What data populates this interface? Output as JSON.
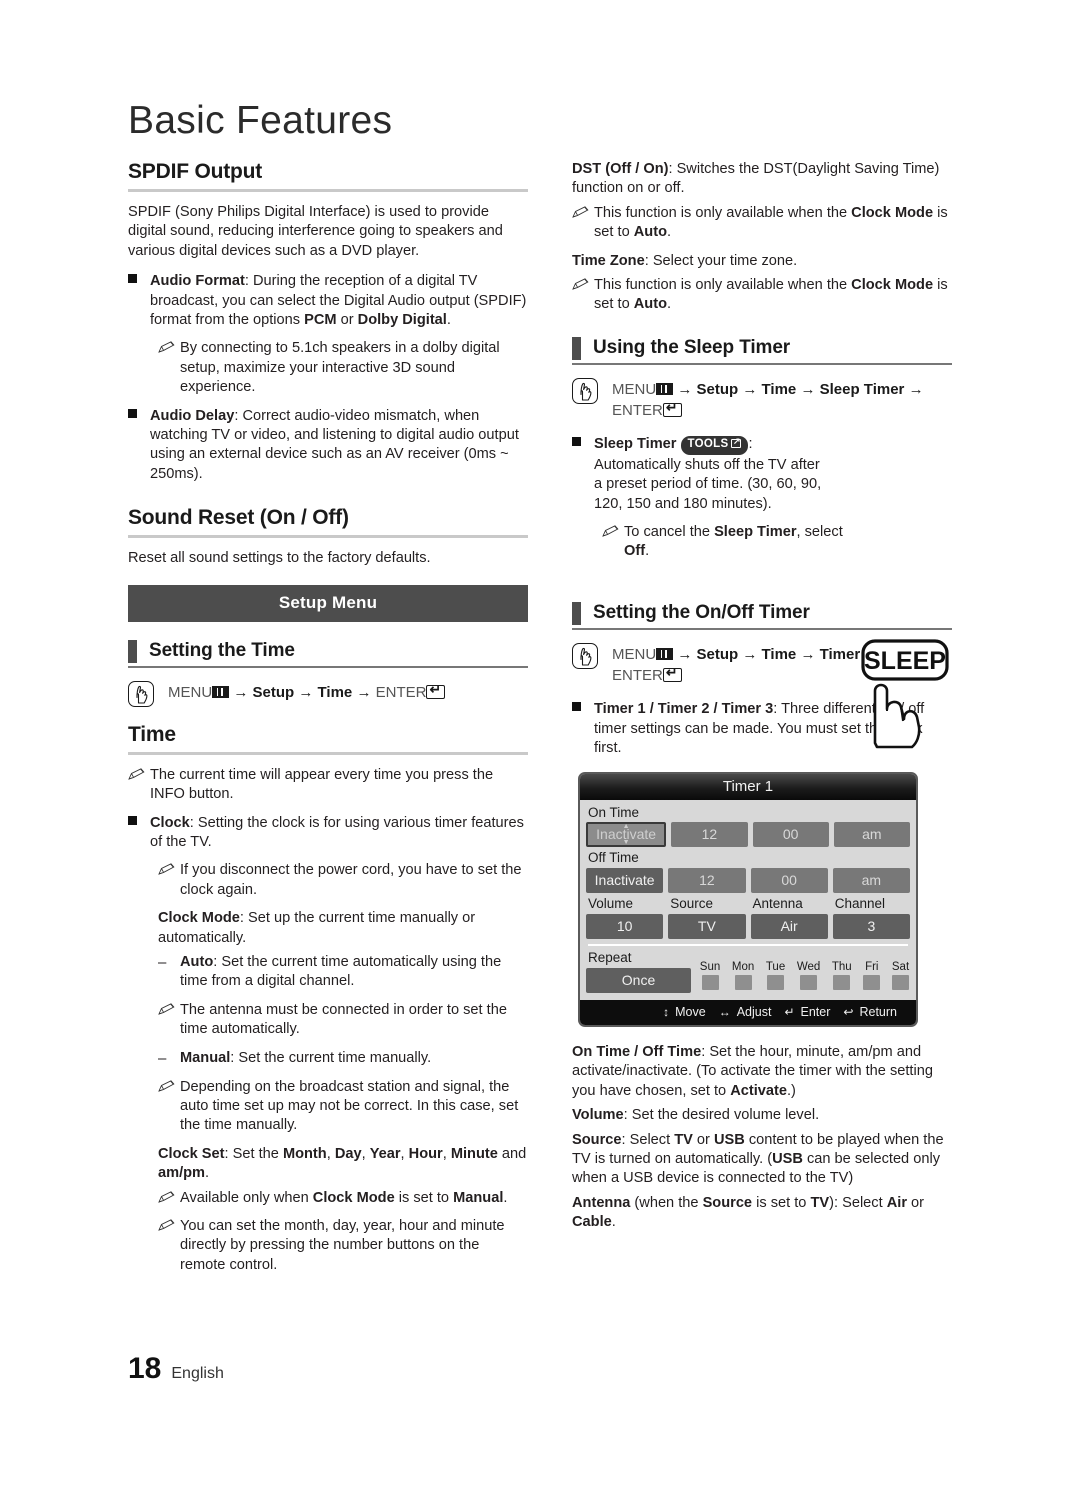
{
  "document": {
    "title": "Basic Features",
    "page_number": "18",
    "language": "English"
  },
  "left_column": {
    "spdif": {
      "heading": "SPDIF Output",
      "intro": "SPDIF (Sony Philips Digital Interface) is used to provide digital sound, reducing interference going to speakers and various digital devices such as a DVD player.",
      "audio_format_term": "Audio Format",
      "audio_format_body": ": During the reception of a digital TV broadcast, you can select the Digital Audio output (SPDIF) format from the options ",
      "audio_format_opt1": "PCM",
      "audio_format_or": " or ",
      "audio_format_opt2": "Dolby Digital",
      "audio_format_end": ".",
      "note_51ch": "By connecting to 5.1ch speakers in a dolby digital setup, maximize your interactive 3D sound experience.",
      "audio_delay_term": "Audio Delay",
      "audio_delay_body": ": Correct audio-video mismatch, when watching TV or video, and listening to digital audio output using an external device such as an AV receiver (0ms ~ 250ms)."
    },
    "sound_reset": {
      "heading": "Sound Reset (On / Off)",
      "body": "Reset all sound settings to the factory defaults."
    },
    "setup_menu_banner": "Setup Menu",
    "setting_the_time": {
      "heading": "Setting the Time",
      "nav": {
        "menu": "MENU",
        "arrow": "→",
        "step1": "Setup",
        "step2": "Time",
        "enter": "ENTER"
      }
    },
    "time": {
      "heading": "Time",
      "note_info_a": "The current time will appear every time you press the ",
      "note_info_b": "INFO",
      "note_info_c": " button.",
      "clock_term": "Clock",
      "clock_body": ": Setting the clock is for using various timer features of the TV.",
      "note_powercord": "If you disconnect the power cord, you have to set the clock again.",
      "clock_mode_term": "Clock Mode",
      "clock_mode_body": ": Set up the current time manually or automatically.",
      "auto_term": "Auto",
      "auto_body": ": Set the current time automatically using the time from a digital channel.",
      "note_antenna": "The antenna must be connected in order to set the time automatically.",
      "manual_term": "Manual",
      "manual_body": ": Set the current time manually.",
      "note_broadcast": "Depending on the broadcast station and signal, the auto time set up may not be correct. In this case, set the time manually.",
      "clock_set_term": "Clock Set",
      "clock_set_b1": ": Set the ",
      "clock_set_fields": [
        "Month",
        "Day",
        "Year",
        "Hour",
        "Minute"
      ],
      "clock_set_b2": " and ",
      "clock_set_ampm": "am/pm",
      "clock_set_end": ".",
      "note_available_a": "Available only when ",
      "note_available_b": "Clock Mode",
      "note_available_c": " is set to ",
      "note_available_d": "Manual",
      "note_available_e": ".",
      "note_numberbuttons": "You can set the month, day, year, hour and minute directly by pressing the number buttons on the remote control."
    }
  },
  "right_column": {
    "dst": {
      "term": "DST (Off / On)",
      "body": ": Switches the DST(Daylight Saving Time) function on or off.",
      "note_a": "This function is only available when the ",
      "note_b": "Clock Mode",
      "note_c": " is set to ",
      "note_d": "Auto",
      "note_e": "."
    },
    "time_zone": {
      "term": "Time Zone",
      "body": ": Select your time zone.",
      "note_a": "This function is only available when the ",
      "note_b": "Clock Mode",
      "note_c": " is set to ",
      "note_d": "Auto",
      "note_e": "."
    },
    "sleep_timer": {
      "heading": "Using the Sleep Timer",
      "nav": {
        "menu": "MENU",
        "arrow": "→",
        "step1": "Setup",
        "step2": "Time",
        "step3": "Sleep Timer",
        "enter": "ENTER"
      },
      "term": "Sleep Timer",
      "tools_badge": "TOOLS",
      "body": ": Automatically shuts off the TV after a preset period of time. (30, 60, 90, 120, 150 and 180 minutes).",
      "note_a": "To cancel the ",
      "note_b": "Sleep Timer",
      "note_c": ", select ",
      "note_d": "Off",
      "note_e": ".",
      "remote_button_label": "SLEEP"
    },
    "onoff_timer": {
      "heading": "Setting the On/Off Timer",
      "nav": {
        "menu": "MENU",
        "arrow": "→",
        "step1": "Setup",
        "step2": "Time",
        "step3": "Timer 1",
        "enter": "ENTER"
      },
      "term": "Timer 1 / Timer 2 / Timer 3",
      "body": ": Three different on / off timer settings can be made. You must set the clock first."
    },
    "timer_dialog": {
      "title": "Timer 1",
      "on_time_label": "On Time",
      "on_time_values": [
        "Inactivate",
        "12",
        "00",
        "am"
      ],
      "on_time_selected_index": 0,
      "off_time_label": "Off Time",
      "off_time_values": [
        "Inactivate",
        "12",
        "00",
        "am"
      ],
      "field_labels": [
        "Volume",
        "Source",
        "Antenna",
        "Channel"
      ],
      "field_values": [
        "10",
        "TV",
        "Air",
        "3"
      ],
      "repeat_label": "Repeat",
      "repeat_value": "Once",
      "days": [
        "Sun",
        "Mon",
        "Tue",
        "Wed",
        "Thu",
        "Fri",
        "Sat"
      ],
      "footer_hints": [
        {
          "key": "↕",
          "label": "Move"
        },
        {
          "key": "↔",
          "label": "Adjust"
        },
        {
          "key": "↵",
          "label": "Enter"
        },
        {
          "key": "↩",
          "label": "Return"
        }
      ]
    },
    "descriptions": {
      "on_off_term": "On Time / Off Time",
      "on_off_b1": ": Set the hour, minute, am/pm and activate/inactivate. (To activate the timer with the setting you have chosen, set to ",
      "on_off_bold": "Activate",
      "on_off_b2": ".)",
      "volume_term": "Volume",
      "volume_body": ": Set the desired volume level.",
      "source_term": "Source",
      "source_b1": ": Select ",
      "source_tv": "TV",
      "source_or": " or ",
      "source_usb": "USB",
      "source_b2": " content to be played when the TV is turned on automatically. (",
      "source_usb2": "USB",
      "source_b3": " can be selected only when a USB device is connected to the TV)",
      "antenna_term": "Antenna",
      "antenna_b1": " (when the ",
      "antenna_source": "Source",
      "antenna_b2": " is set to ",
      "antenna_tv": "TV",
      "antenna_b3": "): Select ",
      "antenna_air": "Air",
      "antenna_b4": " or ",
      "antenna_cable": "Cable",
      "antenna_b5": "."
    }
  },
  "colors": {
    "banner_bg": "#4d4d4d",
    "accent_bar": "#4d4d4d",
    "rule_thick": "#c9c9c9",
    "dialog_bg": "#d8d8d8",
    "dialog_cell": "#787878",
    "text": "#231f20"
  }
}
